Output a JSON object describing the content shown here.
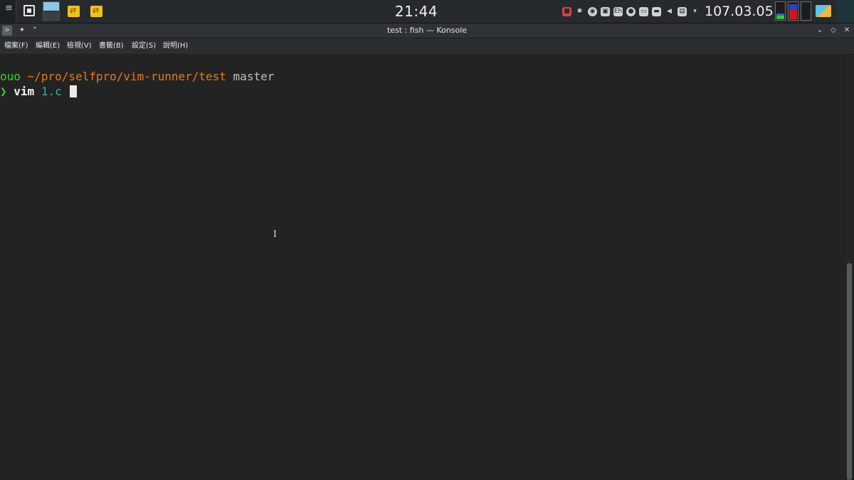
{
  "panel": {
    "launcher_glyph": "≡",
    "clock": "21:44",
    "date": "107.03.05",
    "tray_icons": [
      "camera-icon",
      "bluetooth-icon",
      "chrome-icon",
      "clipboard-icon",
      "input-method-icon",
      "network-globe-icon",
      "display-icon",
      "battery-icon",
      "volume-icon",
      "notes-icon",
      "tray-expand-icon"
    ],
    "tray_glyphs": [
      "■",
      "✱",
      "◉",
      "▣",
      "Eh",
      "●",
      "▭",
      "▬",
      "◀",
      "▤",
      "▾"
    ],
    "task_glyph": "⇄",
    "colors": {
      "cpu_user": "#39c24a",
      "cpu_sys": "#3a5fd8",
      "mem_used": "#cc1a1a",
      "mem_cache": "#2a3fd0"
    }
  },
  "window": {
    "title": "test : fish — Konsole",
    "controls": {
      "pin": "✦",
      "shade": "⌃",
      "minimize": "⌄",
      "maximize": "◇",
      "close": "✕"
    }
  },
  "menu": {
    "items": [
      "檔案(F)",
      "編輯(E)",
      "檢視(V)",
      "書籤(B)",
      "設定(S)",
      "說明(H)"
    ]
  },
  "terminal": {
    "prompt": {
      "user": "ouo",
      "path": "~/pro/selfpro/vim-runner/test",
      "branch": "master"
    },
    "command": {
      "arrow": "❯",
      "cmd": "vim",
      "arg": "1.c"
    },
    "mouse_cursor": "I",
    "colors": {
      "user": "#37d033",
      "path": "#e67a18",
      "branch": "#bfbfbf",
      "arg": "#2bb5a0",
      "background": "#232323"
    }
  }
}
